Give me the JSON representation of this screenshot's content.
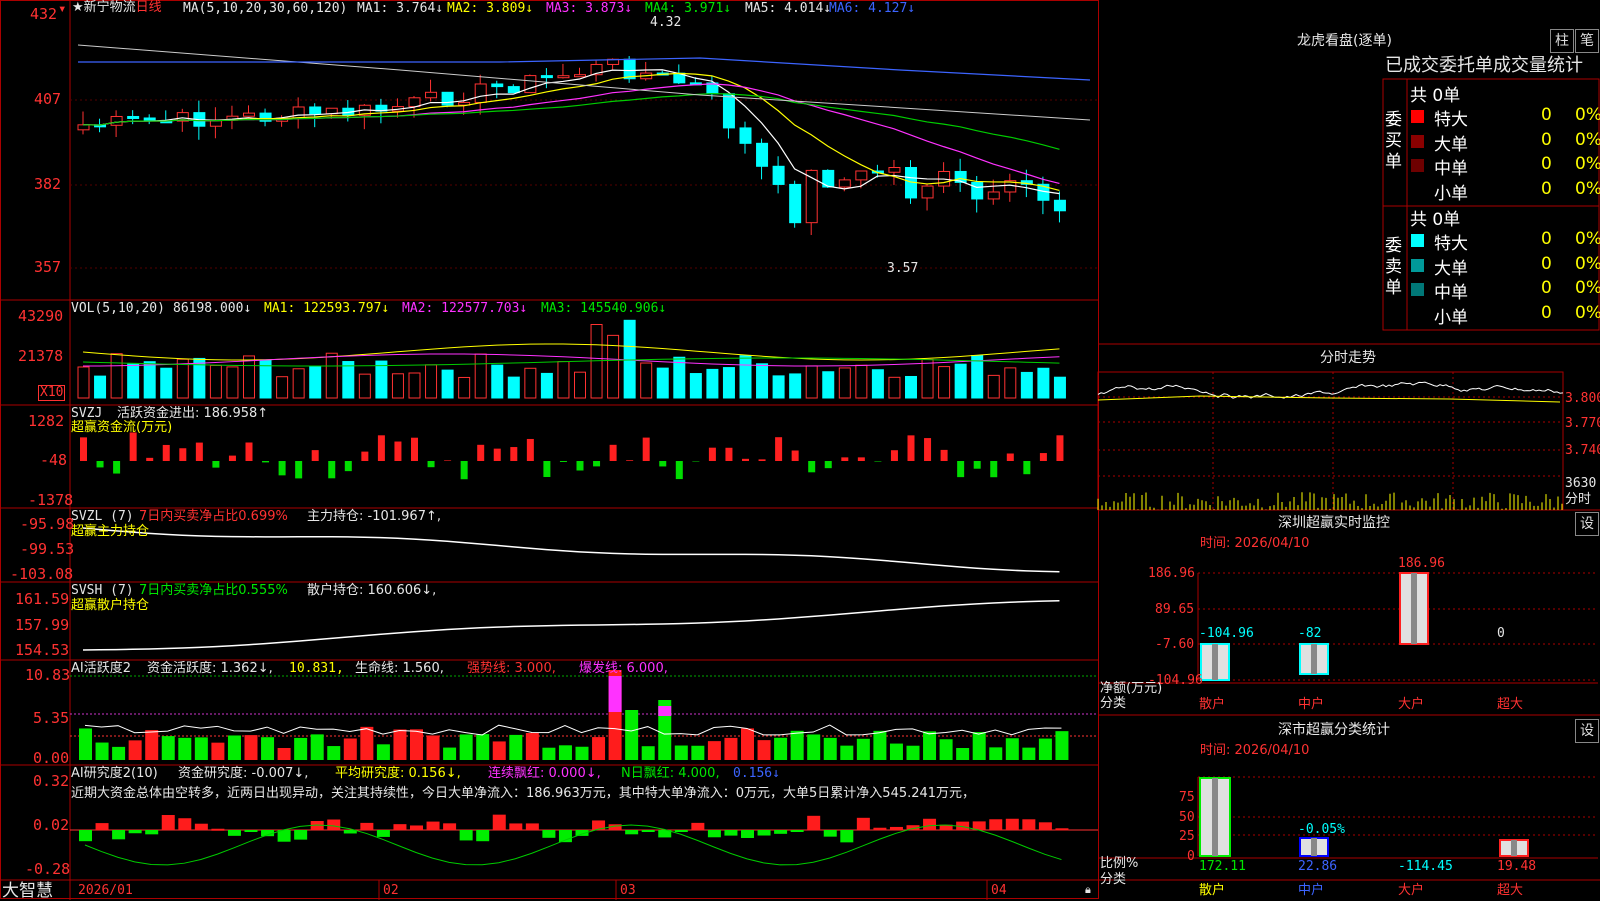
{
  "main_chart": {
    "star": "★",
    "stock_name": "新宁物流",
    "period": "日线",
    "ma_params": "MA(5,10,20,30,60,120)",
    "ma1": "MA1: 3.764↓",
    "ma2": "MA2: 3.809↓",
    "ma3": "MA3: 3.873↓",
    "ma4": "MA4: 3.971↓",
    "ma5": "MA5: 4.014↓",
    "ma6": "MA6: 4.127↓",
    "high_note": "4.32",
    "low_note": "3.57",
    "y_ticks": [
      "432",
      "407",
      "382",
      "357"
    ]
  },
  "vol": {
    "label": "VOL(5,10,20)",
    "value": "86198.000↓",
    "ma1": "MA1: 122593.797↓",
    "ma2": "MA2: 122577.703↓",
    "ma3": "MA3: 145540.906↓",
    "y_ticks": [
      "43290",
      "21378"
    ],
    "unit": "X10"
  },
  "svzj": {
    "label": "SVZJ",
    "desc": "活跃资金进出: 186.958↑",
    "sub": "超赢资金流(万元)",
    "y_ticks": [
      "1282",
      "-48",
      "-1378"
    ]
  },
  "svzl": {
    "label": "SVZL (7)",
    "ratio": "7日内买卖净占比0.699%",
    "hold": "主力持仓: -101.967↑,",
    "sub": "超赢主力持仓",
    "y_ticks": [
      "-95.98",
      "-99.53",
      "-103.08"
    ]
  },
  "svsh": {
    "label": "SVSH (7)",
    "ratio": "7日内买卖净占比0.555%",
    "hold": "散户持仓: 160.606↓,",
    "sub": "超赢散户持仓",
    "y_ticks": [
      "161.59",
      "157.99",
      "154.53"
    ]
  },
  "ai_active": {
    "label": "AI活跃度2",
    "d1": "资金活跃度: 1.362↓,",
    "d2": "10.831,",
    "d3": "生命线: 1.560,",
    "d4": "强势线: 3.000,",
    "d5": "爆发线: 6.000,",
    "y_ticks": [
      "10.83",
      "5.35",
      "0.00"
    ]
  },
  "ai_research": {
    "label": "AI研究度2(10)",
    "d1": "资金研究度: -0.007↓,",
    "d2": "平均研究度: 0.156↓,",
    "d3": "连续飘红: 0.000↓,",
    "d4": "N日飘红: 4.000,",
    "d5": "0.156↓",
    "comment": "近期大资金总体由空转多，近两日出现异动，关注其持续性，今日大单净流入：186.963万元，其中特大单净流入：0万元，大单5日累计净入545.241万元，",
    "y_ticks": [
      "0.32",
      "0.02",
      "-0.28"
    ]
  },
  "bottom_bar": {
    "logo": "大智慧",
    "dates": [
      "2026/01",
      "02",
      "03",
      "04"
    ]
  },
  "lhb": {
    "title": "龙虎看盘(逐单)",
    "btn_col": "柱",
    "btn_pen": "笔",
    "tabs": "已成交委托单成交量统计",
    "buy_side": "委买单",
    "sell_side": "委卖单",
    "buy_total": "共 0单",
    "sell_total": "共 0单",
    "buy_rows": [
      {
        "label": "特大",
        "count": "0",
        "pct": "0%",
        "color": "#ff0000"
      },
      {
        "label": "大单",
        "count": "0",
        "pct": "0%",
        "color": "#8b0000"
      },
      {
        "label": "中单",
        "count": "0",
        "pct": "0%",
        "color": "#6e0000"
      },
      {
        "label": "小单",
        "count": "0",
        "pct": "0%",
        "color": "#000000"
      }
    ],
    "sell_rows": [
      {
        "label": "特大",
        "count": "0",
        "pct": "0%",
        "color": "#00ffff"
      },
      {
        "label": "大单",
        "count": "0",
        "pct": "0%",
        "color": "#009999"
      },
      {
        "label": "中单",
        "count": "0",
        "pct": "0%",
        "color": "#007777"
      },
      {
        "label": "小单",
        "count": "0",
        "pct": "0%",
        "color": "#000000"
      }
    ]
  },
  "intraday": {
    "title": "分时走势",
    "prices": [
      "3.800",
      "3.770",
      "3.740"
    ],
    "vol_label": "3630",
    "vol_unit": "分时"
  },
  "sz_monitor": {
    "title": "深圳超赢实时监控",
    "btn": "设",
    "time": "时间: 2026/04/10",
    "y_ticks": [
      "186.96",
      "89.65",
      "-7.60",
      "-104.96"
    ],
    "axis_label": "净额(万元)",
    "cat_label": "分类",
    "bars": [
      {
        "name": "散户",
        "value": "-104.96"
      },
      {
        "name": "中户",
        "value": "-82"
      },
      {
        "name": "大户",
        "value": "186.96"
      },
      {
        "name": "超大",
        "value": "0"
      }
    ]
  },
  "sz_stat": {
    "title": "深市超赢分类统计",
    "btn": "设",
    "time": "时间: 2026/04/10",
    "y_ticks": [
      "75",
      "50",
      "25",
      "0"
    ],
    "axis_label": "比例%",
    "cat_label": "分类",
    "pct_note": "-0.05%",
    "bars": [
      {
        "name": "散户",
        "value": "172.11"
      },
      {
        "name": "中户",
        "value": "22.86"
      },
      {
        "name": "大户",
        "value": "-114.45"
      },
      {
        "name": "超大",
        "value": "19.48"
      }
    ]
  }
}
